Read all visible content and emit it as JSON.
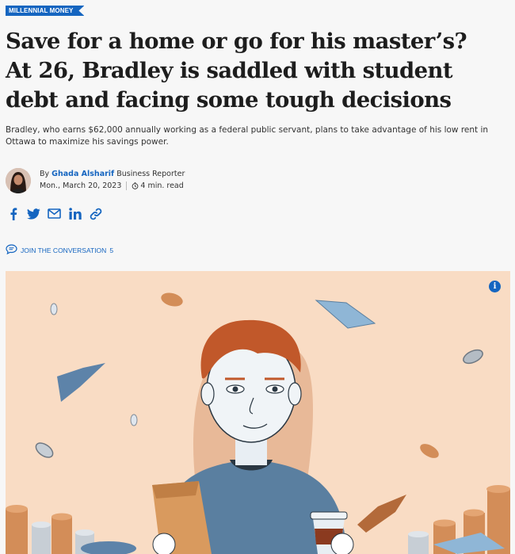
{
  "category_tag": "MILLENNIAL MONEY",
  "headline": "Save for a home or go for his master’s? At 26, Bradley is saddled with student debt and facing some tough decisions",
  "dek": "Bradley, who earns $62,000 annually working as a federal public servant, plans to take advantage of his low rent in Ottawa to maximize his savings power.",
  "byline": {
    "prefix": "By",
    "author": "Ghada Alsharif",
    "role": "Business Reporter",
    "date": "Mon., March 20, 2023",
    "read_time": "4 min. read"
  },
  "share_icons": [
    "facebook-icon",
    "twitter-icon",
    "email-icon",
    "linkedin-icon",
    "link-icon"
  ],
  "conversation": {
    "label": "JOIN THE CONVERSATION",
    "count": "5"
  },
  "colors": {
    "accent": "#1565c0",
    "hero_bg": "#f9dcc4"
  }
}
